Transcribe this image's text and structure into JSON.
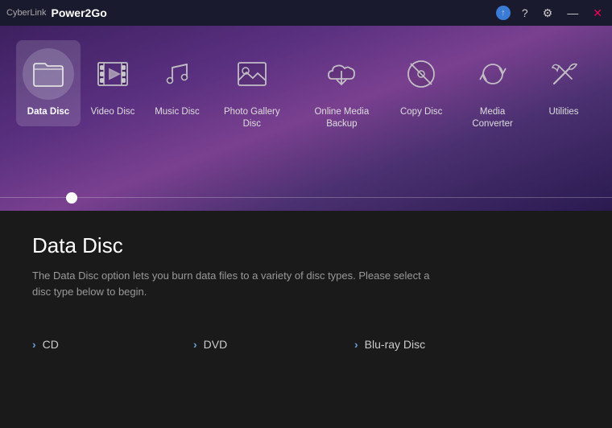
{
  "titleBar": {
    "brand": "CyberLink",
    "appName": "Power2Go",
    "buttons": {
      "update": "↑",
      "help": "?",
      "settings": "⚙",
      "minimize": "—",
      "close": "✕"
    }
  },
  "menu": {
    "items": [
      {
        "id": "data-disc",
        "label": "Data Disc",
        "active": true
      },
      {
        "id": "video-disc",
        "label": "Video Disc",
        "active": false
      },
      {
        "id": "music-disc",
        "label": "Music Disc",
        "active": false
      },
      {
        "id": "photo-gallery-disc",
        "label": "Photo Gallery Disc",
        "active": false
      },
      {
        "id": "online-media-backup",
        "label": "Online Media Backup",
        "active": false
      },
      {
        "id": "copy-disc",
        "label": "Copy Disc",
        "active": false
      },
      {
        "id": "media-converter",
        "label": "Media Converter",
        "active": false
      },
      {
        "id": "utilities",
        "label": "Utilities",
        "active": false
      }
    ]
  },
  "content": {
    "title": "Data Disc",
    "description": "The Data Disc option lets you burn data files to a variety of disc types. Please select a disc type below to begin.",
    "discOptions": [
      {
        "id": "cd",
        "label": "CD"
      },
      {
        "id": "dvd",
        "label": "DVD"
      },
      {
        "id": "blu-ray",
        "label": "Blu-ray Disc"
      }
    ]
  }
}
